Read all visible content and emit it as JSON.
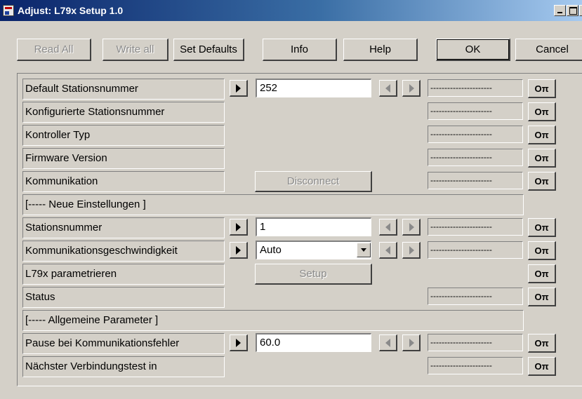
{
  "window": {
    "title": "Adjust: L79x Setup 1.0"
  },
  "toolbar": {
    "read_all": "Read All",
    "write_all": "Write all",
    "set_defaults": "Set Defaults",
    "info": "Info",
    "help": "Help",
    "ok": "OK",
    "cancel": "Cancel"
  },
  "rows": {
    "default_station": {
      "label": "Default Stationsnummer",
      "value": "252",
      "status": "----------------------"
    },
    "configured_station": {
      "label": "Konfigurierte Stationsnummer",
      "status": "----------------------"
    },
    "controller_type": {
      "label": "Kontroller Typ",
      "status": "----------------------"
    },
    "firmware": {
      "label": "Firmware Version",
      "status": "----------------------"
    },
    "communication": {
      "label": "Kommunikation",
      "button": "Disconnect",
      "status": "----------------------"
    },
    "section_new": {
      "label": "[----- Neue Einstellungen ]"
    },
    "station_number": {
      "label": "Stationsnummer",
      "value": "1",
      "status": "----------------------"
    },
    "comm_speed": {
      "label": "Kommunikationsgeschwindigkeit",
      "value": "Auto",
      "status": "----------------------"
    },
    "parametrize": {
      "label": "L79x parametrieren",
      "button": "Setup"
    },
    "status": {
      "label": "Status",
      "status": "----------------------"
    },
    "section_general": {
      "label": "[----- Allgemeine Parameter ]"
    },
    "comm_error_pause": {
      "label": "Pause bei Kommunikationsfehler",
      "value": "60.0",
      "status": "----------------------"
    },
    "next_test": {
      "label": "Nächster Verbindungstest in",
      "status": "----------------------"
    }
  },
  "key_symbol": "Oπ",
  "icons": {
    "app": "app-icon",
    "key": "key-icon",
    "arrow_right": "arrow-right-icon",
    "arrow_left": "arrow-left-icon",
    "dropdown": "chevron-down-icon"
  }
}
